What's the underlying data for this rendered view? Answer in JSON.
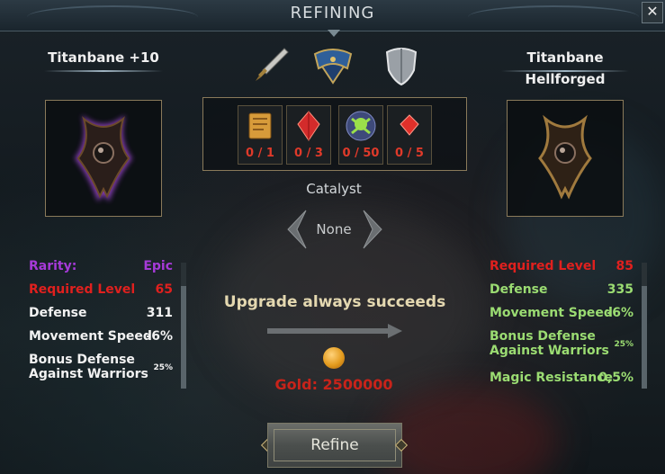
{
  "window": {
    "title": "REFINING",
    "close_glyph": "✕"
  },
  "current_item": {
    "name": "Titanbane +10",
    "icon": "epic-shoulder-armor-icon"
  },
  "result_item": {
    "name": "Titanbane Hellforged",
    "icon": "hellforged-shoulder-armor-icon"
  },
  "equipment_tabs": [
    {
      "icon": "dagger-icon"
    },
    {
      "icon": "shoulder-armor-icon",
      "selected": true
    },
    {
      "icon": "shield-icon"
    }
  ],
  "materials": [
    {
      "icon": "scroll-icon",
      "count": "0 / 1"
    },
    {
      "icon": "red-crystal-icon",
      "count": "0 / 3"
    },
    {
      "icon": "skull-orb-icon",
      "count": "0 / 50"
    },
    {
      "icon": "ruby-icon",
      "count": "0 / 5"
    }
  ],
  "catalyst": {
    "label": "Catalyst",
    "value": "None"
  },
  "left_stats": [
    {
      "label": "Rarity:",
      "value": "Epic",
      "color": "#a63ad8"
    },
    {
      "label": "Required Level",
      "value": "65",
      "color": "#e0201e"
    },
    {
      "label": "Defense",
      "value": "311",
      "color": "#f2f2f2"
    },
    {
      "label": "Movement Speed",
      "value": "-6%",
      "color": "#f2f2f2"
    },
    {
      "label": "Bonus Defense",
      "label2": "Against Warriors",
      "value": "25%",
      "color": "#f2f2f2"
    }
  ],
  "right_stats": [
    {
      "label": "Required Level",
      "value": "85",
      "color": "#e0201e"
    },
    {
      "label": "Defense",
      "value": "335",
      "color": "#9bdc72"
    },
    {
      "label": "Movement Speed",
      "value": "-6%",
      "color": "#9bdc72"
    },
    {
      "label": "Bonus Defense",
      "label2": "Against Warriors",
      "value": "25%",
      "color": "#9bdc72"
    },
    {
      "label": "Magic Resistance",
      "value": "0,5%",
      "color": "#9bdc72"
    }
  ],
  "upgrade": {
    "text": "Upgrade always succeeds",
    "gold": "Gold: 2500000"
  },
  "refine_button": {
    "label": "Refine"
  }
}
